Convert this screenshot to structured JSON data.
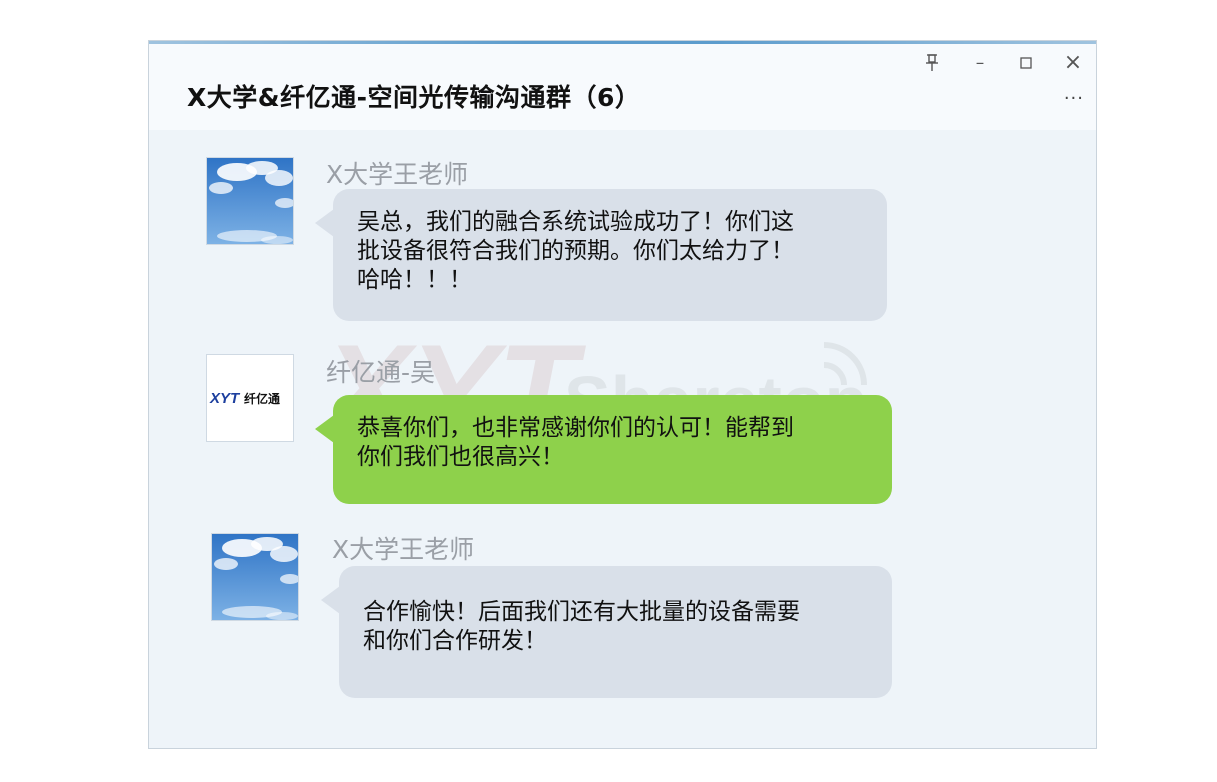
{
  "window": {
    "title": "X大学&纤亿通-空间光传输沟通群（6）",
    "controls": {
      "pin": "⚲",
      "minimize": "–",
      "maximize": "☐",
      "close": "×",
      "more": "···"
    }
  },
  "messages": [
    {
      "sender": "X大学王老师",
      "avatar": "sky-photo",
      "bubble_color": "#d9e0e9",
      "lines": [
        "吴总，我们的融合系统试验成功了！你们这",
        "批设备很符合我们的预期。你们太给力了！",
        "哈哈！！！"
      ]
    },
    {
      "sender": "纤亿通-吴",
      "avatar": "xyt-logo",
      "logo_text": {
        "latin": "XYT",
        "cjk": "纤亿通"
      },
      "bubble_color": "#8ed14b",
      "lines": [
        "恭喜你们，也非常感谢你们的认可！能帮到",
        "你们我们也很高兴！"
      ]
    },
    {
      "sender": "X大学王老师",
      "avatar": "sky-photo",
      "bubble_color": "#d9e0e9",
      "lines": [
        "合作愉快！后面我们还有大批量的设备需要",
        "和你们合作研发！"
      ]
    }
  ],
  "watermark": {
    "text": "XYT Sharetop"
  },
  "colors": {
    "accent": "#5c9ccd",
    "logo_blue": "#1d3f9e",
    "logo_red": "#d9262a"
  }
}
